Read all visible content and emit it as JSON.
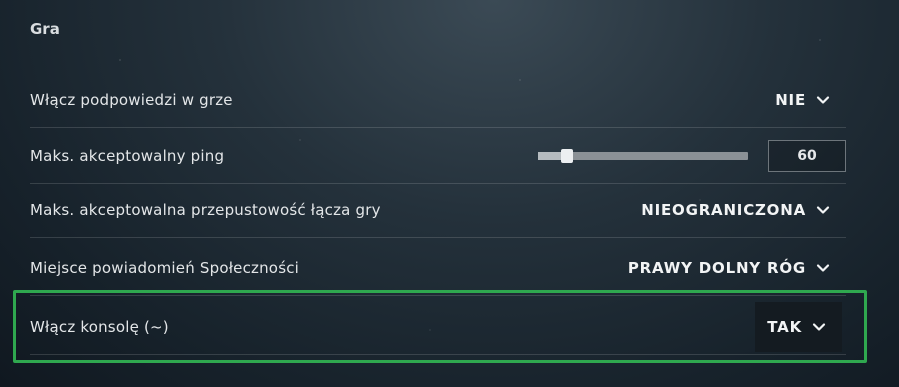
{
  "section": {
    "title": "Gra"
  },
  "settings": [
    {
      "label": "Włącz podpowiedzi w grze",
      "value": "NIE"
    },
    {
      "label": "Maks. akceptowalny ping",
      "value": "60",
      "slider_fraction": 0.14
    },
    {
      "label": "Maks. akceptowalna przepustowość łącza gry",
      "value": "NIEOGRANICZONA"
    },
    {
      "label": "Miejsce powiadomień Społeczności",
      "value": "PRAWY DOLNY RÓG"
    },
    {
      "label": "Włącz konsolę (~)",
      "value": "TAK"
    }
  ],
  "icons": {
    "dropdown": "chevron-down-icon"
  },
  "colors": {
    "highlight": "#2fa84f"
  }
}
